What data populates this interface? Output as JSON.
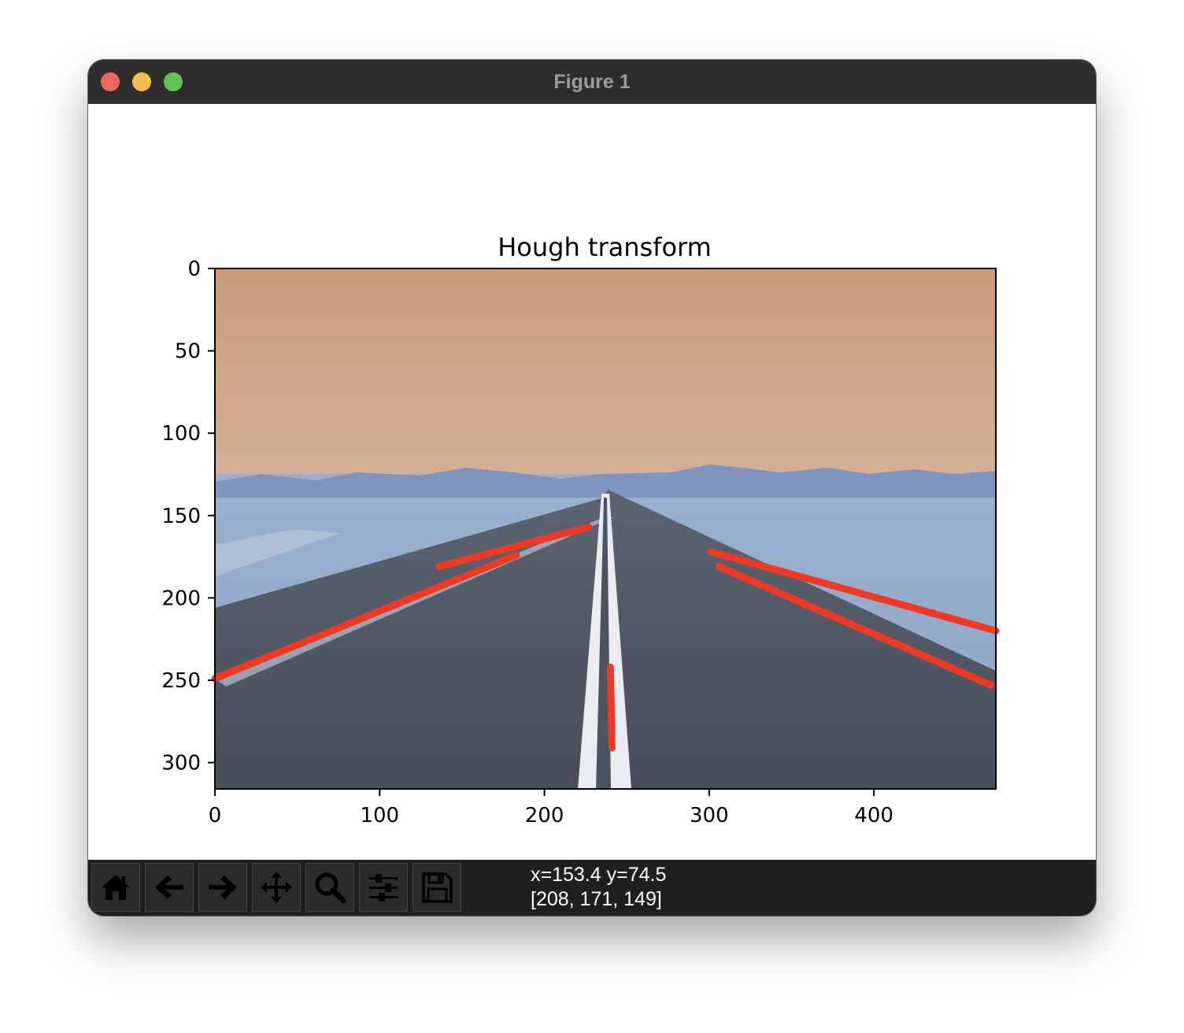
{
  "window": {
    "title": "Figure 1"
  },
  "toolbar": {
    "buttons": [
      {
        "name": "home-button",
        "icon": "home-icon"
      },
      {
        "name": "back-button",
        "icon": "arrow-left-icon"
      },
      {
        "name": "forward-button",
        "icon": "arrow-right-icon"
      },
      {
        "name": "pan-button",
        "icon": "move-icon"
      },
      {
        "name": "zoom-button",
        "icon": "magnifier-icon"
      },
      {
        "name": "configure-subplots-button",
        "icon": "sliders-icon"
      },
      {
        "name": "save-button",
        "icon": "floppy-disk-icon"
      }
    ],
    "coords_line1": "x=153.4 y=74.5",
    "coords_line2": "[208, 171, 149]"
  },
  "chart_data": {
    "type": "image",
    "title": "Hough transform",
    "xlim": [
      0,
      474
    ],
    "ylim": [
      316,
      0
    ],
    "xticks": [
      0,
      100,
      200,
      300,
      400
    ],
    "yticks": [
      0,
      50,
      100,
      150,
      200,
      250,
      300
    ],
    "line_color": "#ee3a24",
    "detected_lines": [
      {
        "x1": 0,
        "y1": 249,
        "x2": 183,
        "y2": 174
      },
      {
        "x1": 136,
        "y1": 181,
        "x2": 227,
        "y2": 157
      },
      {
        "x1": 301,
        "y1": 172,
        "x2": 474,
        "y2": 220
      },
      {
        "x1": 306,
        "y1": 181,
        "x2": 471,
        "y2": 253
      },
      {
        "x1": 240,
        "y1": 242,
        "x2": 241,
        "y2": 291
      }
    ]
  }
}
